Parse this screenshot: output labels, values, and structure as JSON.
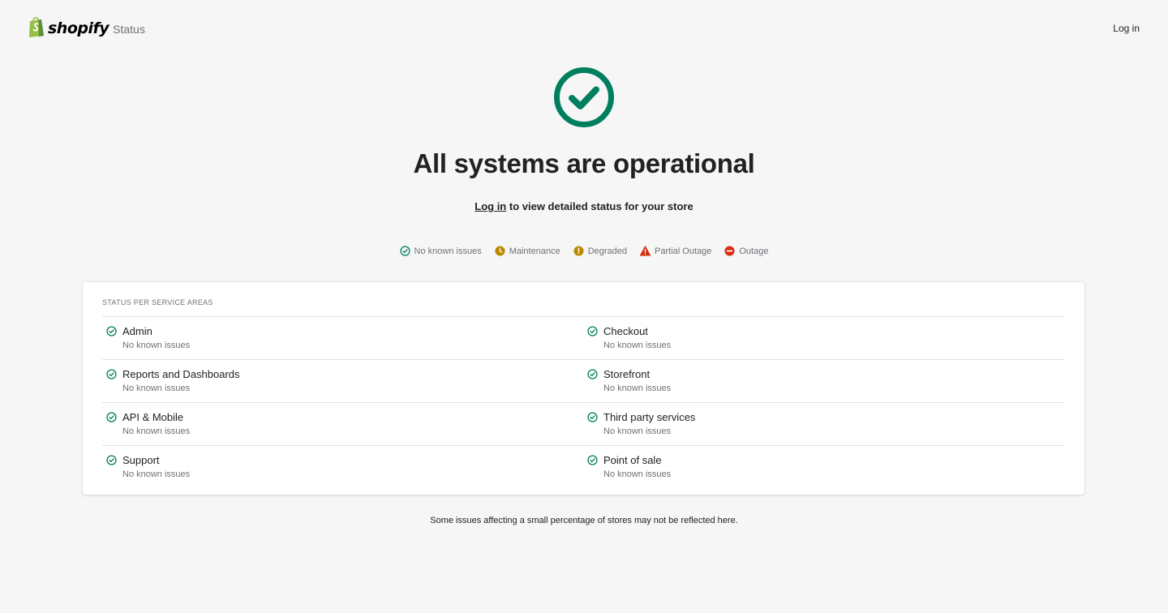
{
  "header": {
    "brand_name": "shopify",
    "brand_suffix": "Status",
    "login_label": "Log in"
  },
  "hero": {
    "title": "All systems are operational",
    "login_link": "Log in",
    "subtitle_rest": " to view detailed status for your store"
  },
  "legend": [
    {
      "label": "No known issues",
      "icon": "check-circle-icon",
      "color": "#007f5f"
    },
    {
      "label": "Maintenance",
      "icon": "clock-icon",
      "color": "#b98900"
    },
    {
      "label": "Degraded",
      "icon": "exclamation-circle-icon",
      "color": "#b98900"
    },
    {
      "label": "Partial Outage",
      "icon": "warning-triangle-icon",
      "color": "#d82c0d"
    },
    {
      "label": "Outage",
      "icon": "minus-circle-icon",
      "color": "#d82c0d"
    }
  ],
  "services": {
    "title": "STATUS PER SERVICE AREAS",
    "items": [
      {
        "name": "Admin",
        "status": "No known issues"
      },
      {
        "name": "Checkout",
        "status": "No known issues"
      },
      {
        "name": "Reports and Dashboards",
        "status": "No known issues"
      },
      {
        "name": "Storefront",
        "status": "No known issues"
      },
      {
        "name": "API & Mobile",
        "status": "No known issues"
      },
      {
        "name": "Third party services",
        "status": "No known issues"
      },
      {
        "name": "Support",
        "status": "No known issues"
      },
      {
        "name": "Point of sale",
        "status": "No known issues"
      }
    ]
  },
  "footer": {
    "note": "Some issues affecting a small percentage of stores may not be reflected here."
  },
  "colors": {
    "ok": "#007f5f",
    "brand_green": "#95bf47",
    "background": "#f6f6f7"
  }
}
